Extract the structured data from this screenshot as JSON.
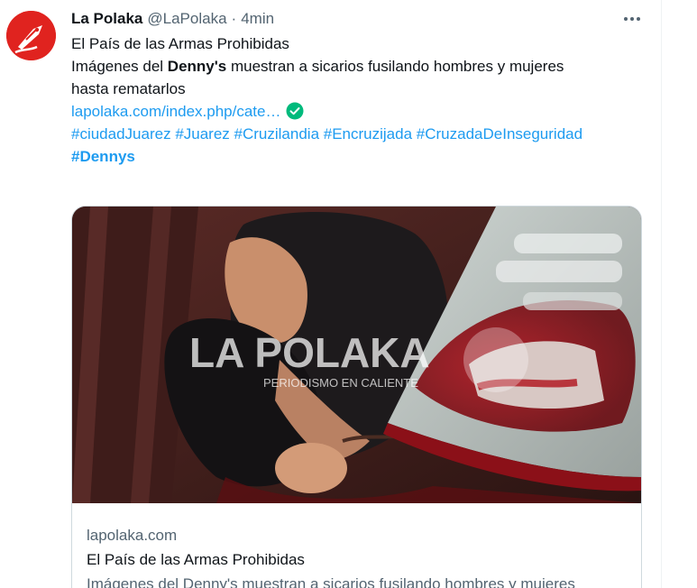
{
  "tweet": {
    "author_name": "La Polaka",
    "author_handle": "@LaPolaka",
    "separator": "·",
    "time": "4min",
    "headline": "El País de las Armas Prohibidas",
    "line2_prefix": "Imágenes del ",
    "line2_bold": "Denny's",
    "line2_suffix": " muestran a sicarios fusilando hombres y mujeres",
    "line3": "hasta rematarlos",
    "link_text": "lapolaka.com/index.php/cate…",
    "hashtags": [
      "#ciudadJuarez",
      "#Juarez",
      "#Cruzilandia",
      "#Encruzijada",
      "#CruzadaDeInseguridad"
    ],
    "hashtag_bold": "#Dennys"
  },
  "card": {
    "watermark_title": "LA POLAKA",
    "watermark_subtitle": "PERIODISMO EN CALIENTE",
    "domain": "lapolaka.com",
    "title": "El País de las Armas Prohibidas",
    "description": "Imágenes del Denny's muestran a sicarios fusilando hombres y mujeres"
  },
  "colors": {
    "accent": "#1d9bf0",
    "verified": "#00ba7c",
    "avatar_bg": "#e0231f",
    "muted": "#536471"
  },
  "icons": {
    "avatar": "pen-nib-logo",
    "more": "more-horizontal-icon",
    "verified": "check-circle-icon"
  }
}
